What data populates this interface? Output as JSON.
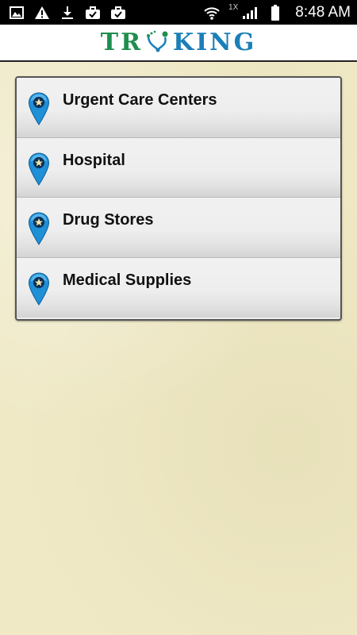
{
  "status_bar": {
    "time": "8:48 AM",
    "network_label": "1X",
    "left_icons": [
      "image-icon",
      "warning-icon",
      "download-icon",
      "briefcase-check-icon",
      "briefcase-check-icon"
    ],
    "right_icons": [
      "wifi-icon",
      "signal-icon",
      "battery-icon"
    ]
  },
  "header": {
    "logo_part1": "TR",
    "logo_part2": "KING",
    "logo_icon": "stethoscope-icon"
  },
  "list": {
    "items": [
      {
        "label": "Urgent Care Centers",
        "icon": "map-pin-star-icon"
      },
      {
        "label": "Hospital",
        "icon": "map-pin-star-icon"
      },
      {
        "label": "Drug Stores",
        "icon": "map-pin-star-icon"
      },
      {
        "label": "Medical Supplies",
        "icon": "map-pin-star-icon"
      }
    ]
  },
  "colors": {
    "background": "#efe9c6",
    "logo_green": "#1f8f4e",
    "logo_blue": "#1b7fb8",
    "pin_blue": "#1f8fd6"
  }
}
